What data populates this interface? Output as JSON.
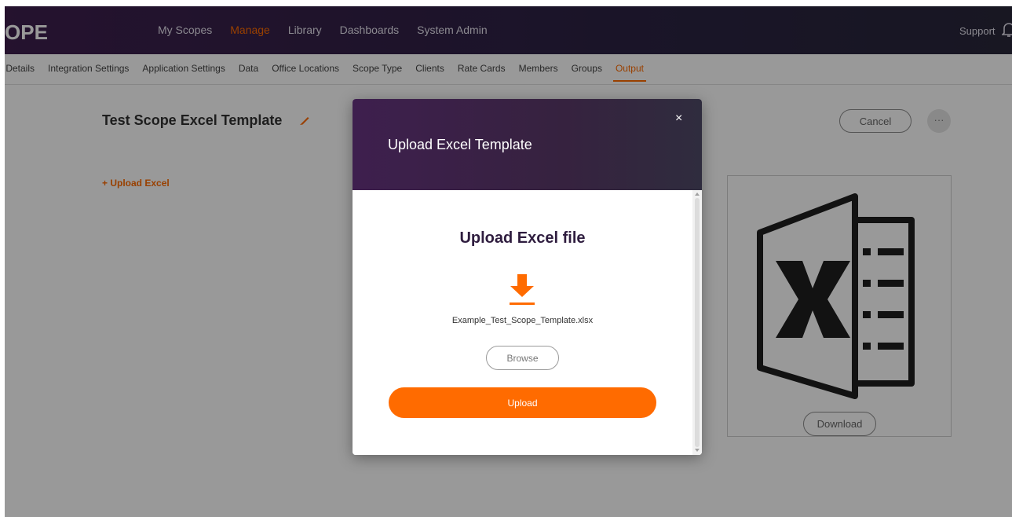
{
  "app": {
    "logo_text": "OPE"
  },
  "topnav": {
    "items": [
      "My Scopes",
      "Manage",
      "Library",
      "Dashboards",
      "System Admin"
    ],
    "active": "Manage",
    "support": "Support"
  },
  "subnav": {
    "items": [
      "y Details",
      "Integration Settings",
      "Application Settings",
      "Data",
      "Office Locations",
      "Scope Type",
      "Clients",
      "Rate Cards",
      "Members",
      "Groups",
      "Output"
    ],
    "active": "Output"
  },
  "page": {
    "title": "Test Scope Excel Template",
    "upload_link": "+ Upload Excel",
    "cancel_label": "Cancel",
    "more_label": "···",
    "download_label": "Download"
  },
  "modal": {
    "title": "Upload Excel Template",
    "close_label": "×",
    "heading": "Upload Excel file",
    "filename": "Example_Test_Scope_Template.xlsx",
    "browse_label": "Browse",
    "upload_label": "Upload"
  },
  "colors": {
    "accent": "#ff6b00",
    "header_purple": "#3e1f4e",
    "overlay": "rgba(0,0,0,0.40)"
  },
  "icons": {
    "bell": "bell-icon",
    "edit": "pencil-icon",
    "close": "close-icon",
    "download_arrow": "download-arrow-icon",
    "excel": "excel-icon"
  }
}
